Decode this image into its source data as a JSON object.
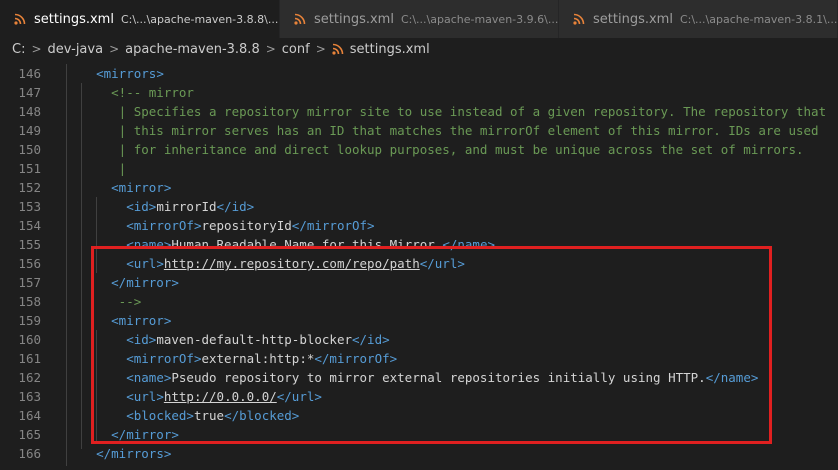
{
  "tabs": [
    {
      "title": "settings.xml",
      "path": "C:\\...\\apache-maven-3.8.8\\...",
      "active": true
    },
    {
      "title": "settings.xml",
      "path": "C:\\...\\apache-maven-3.9.6\\...",
      "active": false
    },
    {
      "title": "settings.xml",
      "path": "C:\\...\\apache-maven-3.8.1\\...",
      "active": false
    }
  ],
  "close_glyph": "×",
  "breadcrumb": [
    "C:",
    "dev-java",
    "apache-maven-3.8.8",
    "conf",
    "settings.xml"
  ],
  "colors": {
    "tag": "#569cd6",
    "comment": "#6a9955",
    "text": "#d4d4d4",
    "highlight": "#e02020",
    "rss": "#e8833a"
  },
  "lines": [
    {
      "n": "146",
      "segs": [
        [
          "t",
          "    "
        ],
        [
          "tag",
          "<mirrors>"
        ]
      ]
    },
    {
      "n": "147",
      "segs": [
        [
          "cm",
          "      <!-- mirror"
        ]
      ]
    },
    {
      "n": "148",
      "segs": [
        [
          "cm",
          "       | Specifies a repository mirror site to use instead of a given repository. The repository that"
        ]
      ]
    },
    {
      "n": "149",
      "segs": [
        [
          "cm",
          "       | this mirror serves has an ID that matches the mirrorOf element of this mirror. IDs are used"
        ]
      ]
    },
    {
      "n": "150",
      "segs": [
        [
          "cm",
          "       | for inheritance and direct lookup purposes, and must be unique across the set of mirrors."
        ]
      ]
    },
    {
      "n": "151",
      "segs": [
        [
          "cm",
          "       |"
        ]
      ]
    },
    {
      "n": "152",
      "segs": [
        [
          "t",
          "      "
        ],
        [
          "tag",
          "<mirror>"
        ]
      ]
    },
    {
      "n": "153",
      "segs": [
        [
          "t",
          "        "
        ],
        [
          "tag",
          "<id>"
        ],
        [
          "t",
          "mirrorId"
        ],
        [
          "tag",
          "</id>"
        ]
      ]
    },
    {
      "n": "154",
      "segs": [
        [
          "t",
          "        "
        ],
        [
          "tag",
          "<mirrorOf>"
        ],
        [
          "t",
          "repositoryId"
        ],
        [
          "tag",
          "</mirrorOf>"
        ]
      ]
    },
    {
      "n": "155",
      "segs": [
        [
          "t",
          "        "
        ],
        [
          "tag",
          "<name>"
        ],
        [
          "t",
          "Human Readable Name for this Mirror."
        ],
        [
          "tag",
          "</name>"
        ]
      ]
    },
    {
      "n": "156",
      "segs": [
        [
          "t",
          "        "
        ],
        [
          "tag",
          "<url>"
        ],
        [
          "link",
          "http://my.repository.com/repo/path"
        ],
        [
          "tag",
          "</url>"
        ]
      ]
    },
    {
      "n": "157",
      "segs": [
        [
          "t",
          "      "
        ],
        [
          "tag",
          "</mirror>"
        ]
      ]
    },
    {
      "n": "158",
      "segs": [
        [
          "cm",
          "       -->"
        ]
      ]
    },
    {
      "n": "159",
      "segs": [
        [
          "t",
          "      "
        ],
        [
          "tag",
          "<mirror>"
        ]
      ]
    },
    {
      "n": "160",
      "segs": [
        [
          "t",
          "        "
        ],
        [
          "tag",
          "<id>"
        ],
        [
          "t",
          "maven-default-http-blocker"
        ],
        [
          "tag",
          "</id>"
        ]
      ]
    },
    {
      "n": "161",
      "segs": [
        [
          "t",
          "        "
        ],
        [
          "tag",
          "<mirrorOf>"
        ],
        [
          "t",
          "external:http:*"
        ],
        [
          "tag",
          "</mirrorOf>"
        ]
      ]
    },
    {
      "n": "162",
      "segs": [
        [
          "t",
          "        "
        ],
        [
          "tag",
          "<name>"
        ],
        [
          "t",
          "Pseudo repository to mirror external repositories initially using HTTP."
        ],
        [
          "tag",
          "</name>"
        ]
      ]
    },
    {
      "n": "163",
      "segs": [
        [
          "t",
          "        "
        ],
        [
          "tag",
          "<url>"
        ],
        [
          "link",
          "http://0.0.0.0/"
        ],
        [
          "tag",
          "</url>"
        ]
      ]
    },
    {
      "n": "164",
      "segs": [
        [
          "t",
          "        "
        ],
        [
          "tag",
          "<blocked>"
        ],
        [
          "t",
          "true"
        ],
        [
          "tag",
          "</blocked>"
        ]
      ]
    },
    {
      "n": "165",
      "segs": [
        [
          "t",
          "      "
        ],
        [
          "tag",
          "</mirror>"
        ]
      ]
    },
    {
      "n": "166",
      "segs": [
        [
          "t",
          "    "
        ],
        [
          "tag",
          "</mirrors>"
        ]
      ]
    }
  ]
}
